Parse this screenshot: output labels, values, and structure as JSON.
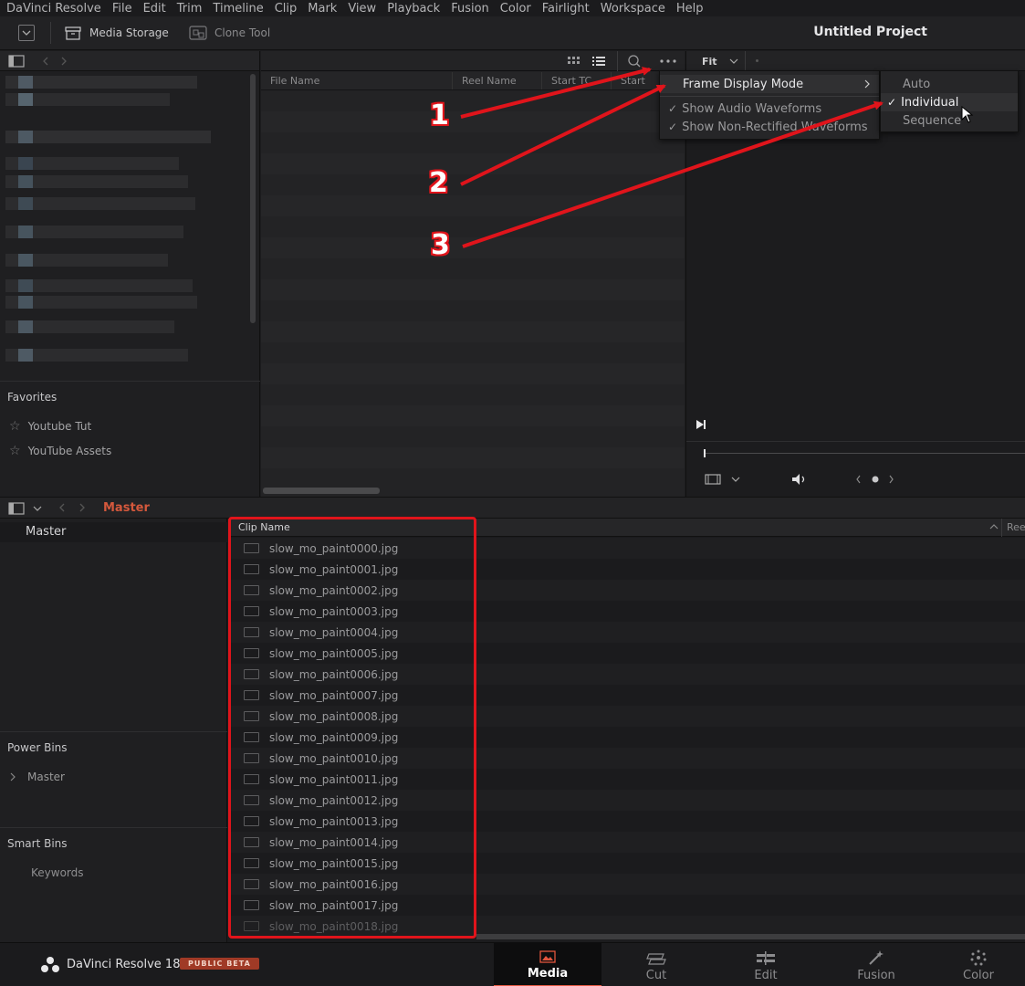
{
  "menubar": [
    "DaVinci Resolve",
    "File",
    "Edit",
    "Trim",
    "Timeline",
    "Clip",
    "Mark",
    "View",
    "Playback",
    "Fusion",
    "Color",
    "Fairlight",
    "Workspace",
    "Help"
  ],
  "toolbar": {
    "media_storage_label": "Media Storage",
    "clone_tool_label": "Clone Tool",
    "project_title": "Untitled Project",
    "zoom_label": "Fit"
  },
  "file_list": {
    "columns": [
      "File Name",
      "Reel Name",
      "Start TC",
      "Start"
    ]
  },
  "favorites": {
    "title": "Favorites",
    "items": [
      "Youtube Tut",
      "YouTube Assets"
    ]
  },
  "context_menu": {
    "frame_display_mode": "Frame Display Mode",
    "show_audio_waveforms": "Show Audio Waveforms",
    "show_non_rectified": "Show Non-Rectified Waveforms"
  },
  "submenu": {
    "auto": "Auto",
    "individual": "Individual",
    "sequence": "Sequence"
  },
  "annotations": [
    "1",
    "2",
    "3"
  ],
  "bin_bar": {
    "breadcrumb": "Master"
  },
  "bins": {
    "master": "Master",
    "power_bins_title": "Power Bins",
    "power_bins_master": "Master",
    "smart_bins_title": "Smart Bins",
    "keywords": "Keywords"
  },
  "clip_list": {
    "header": "Clip Name",
    "reel_header": "Ree",
    "clips": [
      "slow_mo_paint0000.jpg",
      "slow_mo_paint0001.jpg",
      "slow_mo_paint0002.jpg",
      "slow_mo_paint0003.jpg",
      "slow_mo_paint0004.jpg",
      "slow_mo_paint0005.jpg",
      "slow_mo_paint0006.jpg",
      "slow_mo_paint0007.jpg",
      "slow_mo_paint0008.jpg",
      "slow_mo_paint0009.jpg",
      "slow_mo_paint0010.jpg",
      "slow_mo_paint0011.jpg",
      "slow_mo_paint0012.jpg",
      "slow_mo_paint0013.jpg",
      "slow_mo_paint0014.jpg",
      "slow_mo_paint0015.jpg",
      "slow_mo_paint0016.jpg",
      "slow_mo_paint0017.jpg",
      "slow_mo_paint0018.jpg"
    ]
  },
  "footer": {
    "app_name": "DaVinci Resolve 18",
    "beta_badge": "PUBLIC BETA",
    "tabs": [
      "Media",
      "Cut",
      "Edit",
      "Fusion",
      "Color"
    ]
  },
  "colors": {
    "accent_red": "#e0141b",
    "breadcrumb": "#d4583c",
    "badge": "#a03a26"
  }
}
